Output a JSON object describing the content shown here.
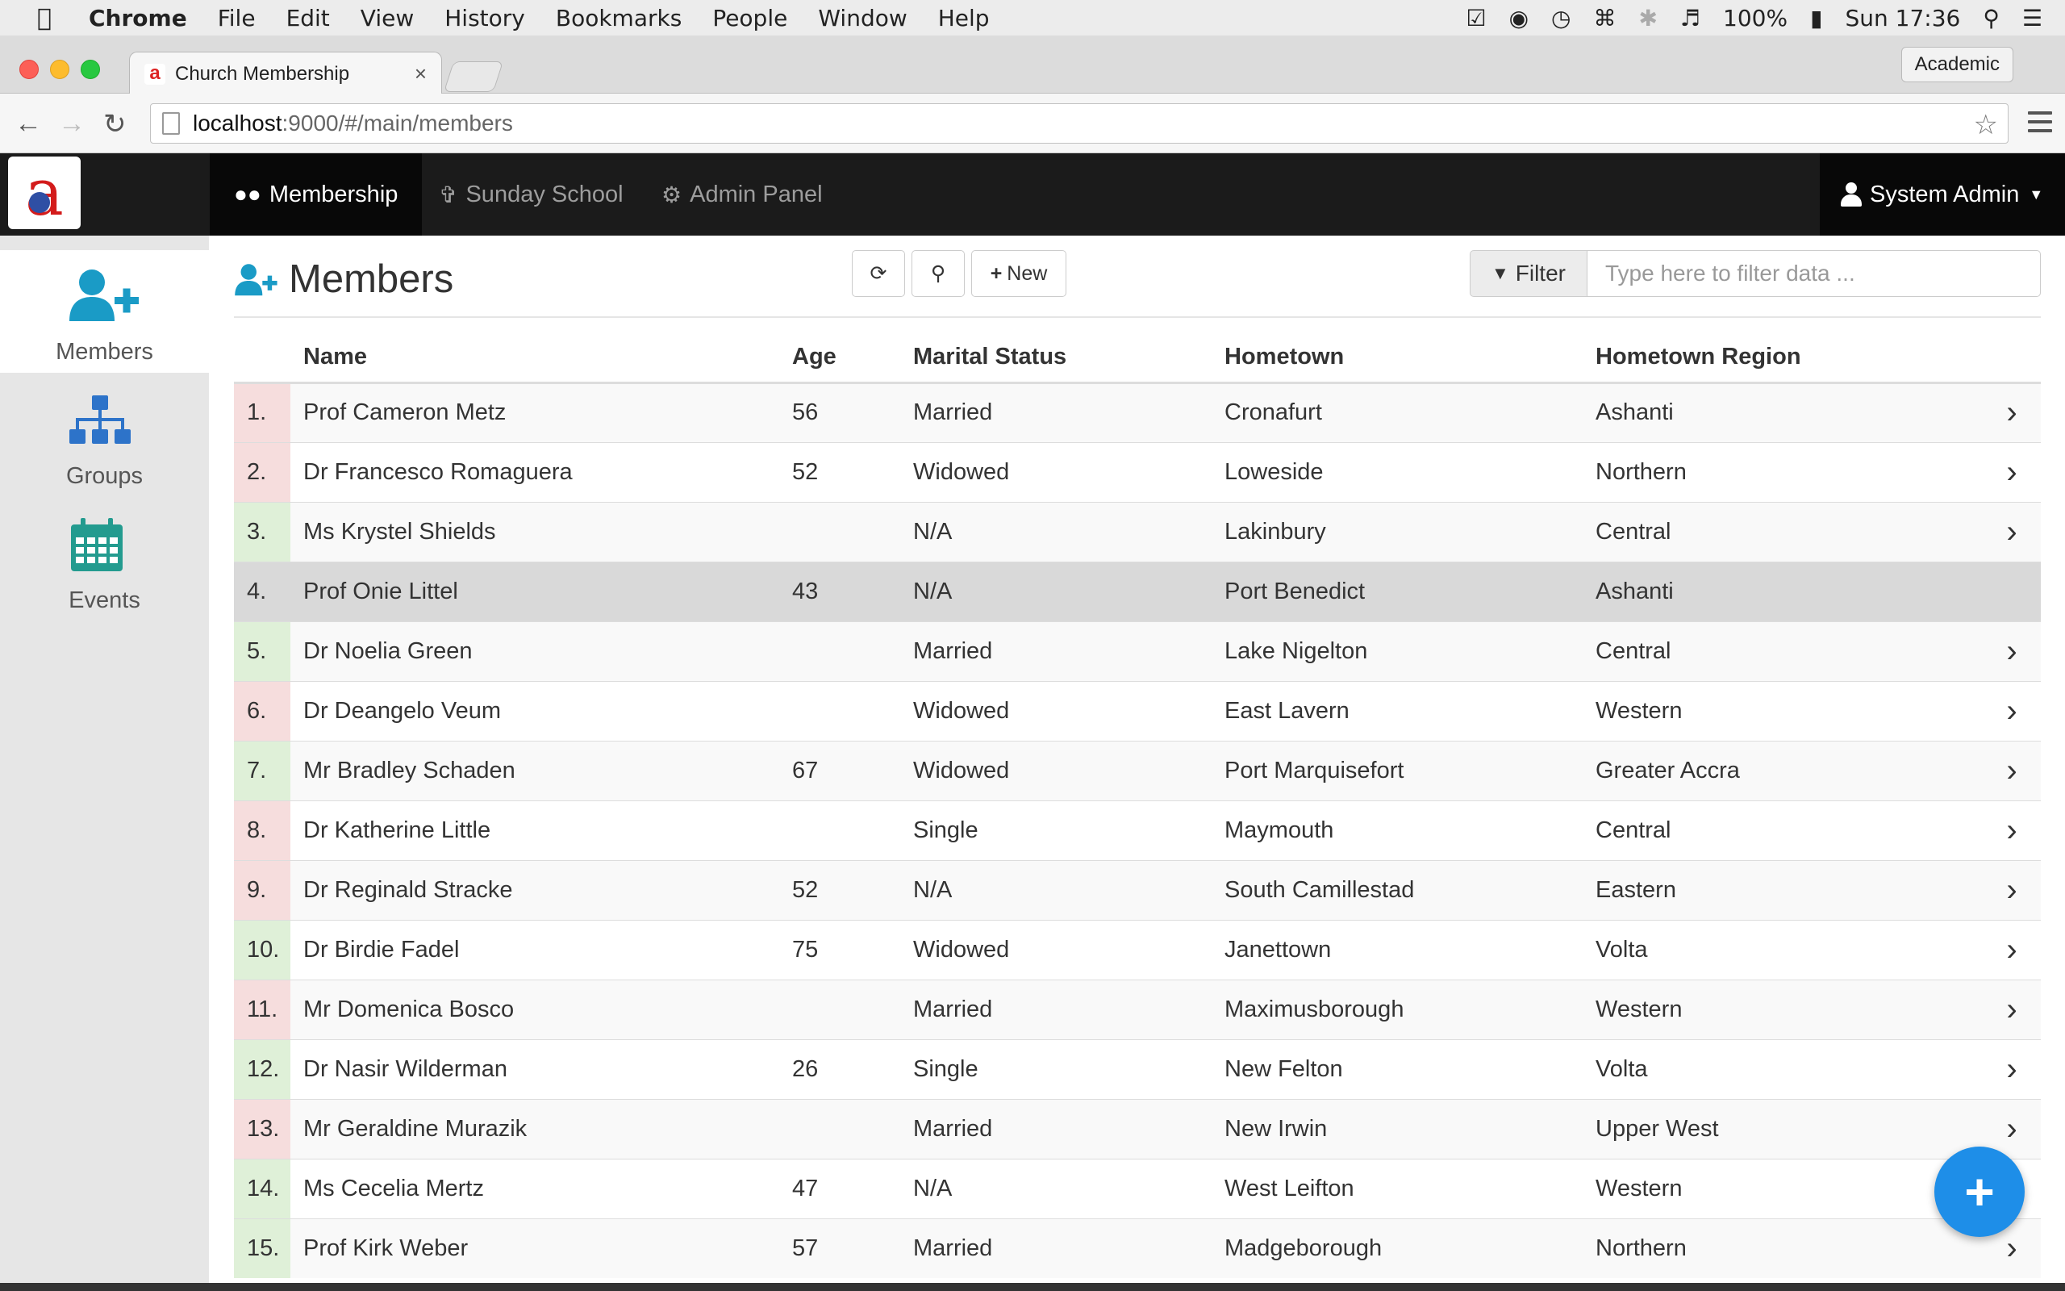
{
  "menubar": {
    "app": "Chrome",
    "items": [
      "File",
      "Edit",
      "View",
      "History",
      "Bookmarks",
      "People",
      "Window",
      "Help"
    ],
    "battery": "100%",
    "clock": "Sun 17:36"
  },
  "browser": {
    "tab_title": "Church Membership",
    "profile": "Academic",
    "url_host": "localhost",
    "url_path": ":9000/#/main/members"
  },
  "navbar": {
    "links": [
      {
        "label": "Membership",
        "icon": "users-icon"
      },
      {
        "label": "Sunday School",
        "icon": "child-icon"
      },
      {
        "label": "Admin Panel",
        "icon": "gears-icon"
      }
    ],
    "user": "System Admin"
  },
  "sidebar": {
    "items": [
      {
        "label": "Members",
        "icon": "user-plus-icon"
      },
      {
        "label": "Groups",
        "icon": "sitemap-icon"
      },
      {
        "label": "Events",
        "icon": "calendar-icon"
      }
    ]
  },
  "page": {
    "title": "Members",
    "new_label": "New",
    "filter_label": "Filter",
    "filter_placeholder": "Type here to filter data ..."
  },
  "table": {
    "columns": [
      "Name",
      "Age",
      "Marital Status",
      "Hometown",
      "Hometown Region"
    ],
    "rows": [
      {
        "num": "1.",
        "name": "Prof Cameron Metz",
        "age": "56",
        "marital": "Married",
        "hometown": "Cronafurt",
        "region": "Ashanti",
        "flag": "red"
      },
      {
        "num": "2.",
        "name": "Dr Francesco Romaguera",
        "age": "52",
        "marital": "Widowed",
        "hometown": "Loweside",
        "region": "Northern",
        "flag": "red"
      },
      {
        "num": "3.",
        "name": "Ms Krystel Shields",
        "age": "",
        "marital": "N/A",
        "hometown": "Lakinbury",
        "region": "Central",
        "flag": "green"
      },
      {
        "num": "4.",
        "name": "Prof Onie Littel",
        "age": "43",
        "marital": "N/A",
        "hometown": "Port Benedict",
        "region": "Ashanti",
        "flag": "none"
      },
      {
        "num": "5.",
        "name": "Dr Noelia Green",
        "age": "",
        "marital": "Married",
        "hometown": "Lake Nigelton",
        "region": "Central",
        "flag": "green"
      },
      {
        "num": "6.",
        "name": "Dr Deangelo Veum",
        "age": "",
        "marital": "Widowed",
        "hometown": "East Lavern",
        "region": "Western",
        "flag": "red"
      },
      {
        "num": "7.",
        "name": "Mr Bradley Schaden",
        "age": "67",
        "marital": "Widowed",
        "hometown": "Port Marquisefort",
        "region": "Greater Accra",
        "flag": "green"
      },
      {
        "num": "8.",
        "name": "Dr Katherine Little",
        "age": "",
        "marital": "Single",
        "hometown": "Maymouth",
        "region": "Central",
        "flag": "red"
      },
      {
        "num": "9.",
        "name": "Dr Reginald Stracke",
        "age": "52",
        "marital": "N/A",
        "hometown": "South Camillestad",
        "region": "Eastern",
        "flag": "red"
      },
      {
        "num": "10.",
        "name": "Dr Birdie Fadel",
        "age": "75",
        "marital": "Widowed",
        "hometown": "Janettown",
        "region": "Volta",
        "flag": "green"
      },
      {
        "num": "11.",
        "name": "Mr Domenica Bosco",
        "age": "",
        "marital": "Married",
        "hometown": "Maximusborough",
        "region": "Western",
        "flag": "red"
      },
      {
        "num": "12.",
        "name": "Dr Nasir Wilderman",
        "age": "26",
        "marital": "Single",
        "hometown": "New Felton",
        "region": "Volta",
        "flag": "green"
      },
      {
        "num": "13.",
        "name": "Mr Geraldine Murazik",
        "age": "",
        "marital": "Married",
        "hometown": "New Irwin",
        "region": "Upper West",
        "flag": "red"
      },
      {
        "num": "14.",
        "name": "Ms Cecelia Mertz",
        "age": "47",
        "marital": "N/A",
        "hometown": "West Leifton",
        "region": "Western",
        "flag": "green"
      },
      {
        "num": "15.",
        "name": "Prof Kirk Weber",
        "age": "57",
        "marital": "Married",
        "hometown": "Madgeborough",
        "region": "Northern",
        "flag": "green"
      }
    ]
  },
  "colors": {
    "accent": "#1e8ee8",
    "sidebar_icon": "#1a9bc6",
    "navbar": "#1b1b1b",
    "flag_red": "#f6dddd",
    "flag_green": "#dff0d8"
  }
}
